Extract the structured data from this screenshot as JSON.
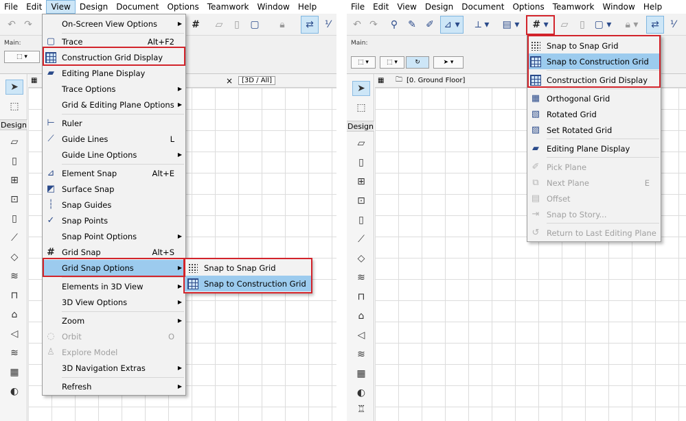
{
  "left": {
    "menubar": [
      "File",
      "Edit",
      "View",
      "Design",
      "Document",
      "Options",
      "Teamwork",
      "Window",
      "Help"
    ],
    "active_menu": "View",
    "toolbar_main_label": "Main:",
    "toolbox_section": "Design",
    "tab_label": "[3D / All]",
    "tab_close": "×",
    "view_menu": [
      {
        "label": "On-Screen View Options",
        "shortcut": "",
        "submenu": true,
        "icon": ""
      },
      {
        "label": "Trace",
        "shortcut": "Alt+F2",
        "submenu": false,
        "icon": "trace-icon"
      },
      {
        "label": "Construction Grid Display",
        "shortcut": "",
        "submenu": false,
        "icon": "construction-grid-icon"
      },
      {
        "label": "Editing Plane Display",
        "shortcut": "",
        "submenu": false,
        "icon": "editing-plane-icon"
      },
      {
        "label": "Trace Options",
        "shortcut": "",
        "submenu": true,
        "icon": ""
      },
      {
        "label": "Grid & Editing Plane Options",
        "shortcut": "",
        "submenu": true,
        "icon": ""
      },
      {
        "label": "Ruler",
        "shortcut": "",
        "submenu": false,
        "icon": "ruler-icon"
      },
      {
        "label": "Guide Lines",
        "shortcut": "L",
        "submenu": false,
        "icon": "guide-lines-icon"
      },
      {
        "label": "Guide Line Options",
        "shortcut": "",
        "submenu": true,
        "icon": ""
      },
      {
        "label": "Element Snap",
        "shortcut": "Alt+E",
        "submenu": false,
        "icon": "element-snap-icon"
      },
      {
        "label": "Surface Snap",
        "shortcut": "",
        "submenu": false,
        "icon": "surface-snap-icon"
      },
      {
        "label": "Snap Guides",
        "shortcut": "",
        "submenu": false,
        "icon": "snap-guides-icon"
      },
      {
        "label": "Snap Points",
        "shortcut": "",
        "submenu": false,
        "icon": "snap-points-icon"
      },
      {
        "label": "Snap Point Options",
        "shortcut": "",
        "submenu": true,
        "icon": ""
      },
      {
        "label": "Grid Snap",
        "shortcut": "Alt+S",
        "submenu": false,
        "icon": "grid-snap-icon"
      },
      {
        "label": "Grid Snap Options",
        "shortcut": "",
        "submenu": true,
        "icon": ""
      },
      {
        "label": "Elements in 3D View",
        "shortcut": "",
        "submenu": true,
        "icon": ""
      },
      {
        "label": "3D View Options",
        "shortcut": "",
        "submenu": true,
        "icon": ""
      },
      {
        "label": "Zoom",
        "shortcut": "",
        "submenu": true,
        "icon": ""
      },
      {
        "label": "Orbit",
        "shortcut": "O",
        "submenu": false,
        "icon": "orbit-icon"
      },
      {
        "label": "Explore Model",
        "shortcut": "",
        "submenu": false,
        "icon": "explore-model-icon"
      },
      {
        "label": "3D Navigation Extras",
        "shortcut": "",
        "submenu": true,
        "icon": ""
      },
      {
        "label": "Refresh",
        "shortcut": "",
        "submenu": true,
        "icon": ""
      }
    ],
    "grid_snap_submenu": [
      {
        "label": "Snap to Snap Grid",
        "icon": "snap-grid-icon"
      },
      {
        "label": "Snap to Construction Grid",
        "icon": "construction-grid-icon"
      }
    ]
  },
  "right": {
    "menubar": [
      "File",
      "Edit",
      "View",
      "Design",
      "Document",
      "Options",
      "Teamwork",
      "Window",
      "Help"
    ],
    "toolbar_main_label": "Main:",
    "toolbox_section": "Design",
    "tab_label": "[0. Ground Floor]",
    "grid_dropdown": [
      {
        "label": "Snap to Snap Grid",
        "icon": "snap-grid-icon",
        "disabled": false
      },
      {
        "label": "Snap to Construction Grid",
        "icon": "construction-grid-icon",
        "disabled": false
      },
      {
        "label": "Construction Grid Display",
        "icon": "construction-grid-icon",
        "disabled": false
      },
      {
        "label": "Orthogonal Grid",
        "icon": "orthogonal-grid-icon",
        "disabled": false
      },
      {
        "label": "Rotated Grid",
        "icon": "rotated-grid-icon",
        "disabled": false
      },
      {
        "label": "Set Rotated Grid",
        "icon": "set-rotated-grid-icon",
        "disabled": false
      },
      {
        "label": "Editing Plane Display",
        "icon": "editing-plane-icon",
        "disabled": false
      },
      {
        "label": "Pick Plane",
        "icon": "pick-plane-icon",
        "disabled": true
      },
      {
        "label": "Next Plane",
        "icon": "next-plane-icon",
        "disabled": true,
        "shortcut": "E"
      },
      {
        "label": "Offset",
        "icon": "offset-icon",
        "disabled": true
      },
      {
        "label": "Snap to Story...",
        "icon": "snap-story-icon",
        "disabled": true
      },
      {
        "label": "Return to Last Editing Plane",
        "icon": "return-plane-icon",
        "disabled": true
      }
    ]
  },
  "colors": {
    "highlight": "#9ccbee",
    "annotation": "#d2232a",
    "menu_bg": "#f2f2f2"
  }
}
